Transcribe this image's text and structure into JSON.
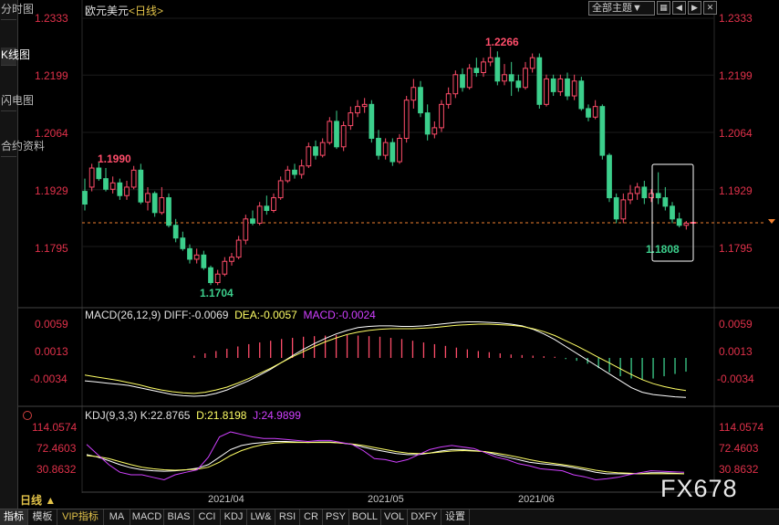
{
  "left_tabs": [
    "分时图",
    "K线图",
    "闪电图",
    "合约资料"
  ],
  "header": {
    "symbol": "欧元美元",
    "period_open": "<",
    "period": "日线",
    "period_close": ">",
    "theme_select": "全部主题▼",
    "window_buttons": [
      "▦",
      "◀",
      "▶",
      "✕"
    ]
  },
  "price_axis": [
    "1.2333",
    "1.2199",
    "1.2064",
    "1.1929",
    "1.1795"
  ],
  "annotations": {
    "low_left": "1.1704",
    "high_left": "1.1990",
    "peak": "1.2266",
    "last_low": "1.1808"
  },
  "macd": {
    "title": "MACD(26,12,9)",
    "diff": "DIFF:-0.0069",
    "dea": "DEA:-0.0057",
    "macd": "MACD:-0.0024",
    "axis": [
      "0.0059",
      "0.0013",
      "-0.0034"
    ]
  },
  "kdj": {
    "title": "KDJ(9,3,3)",
    "k": "K:22.8765",
    "d": "D:21.8198",
    "j": "J:24.9899",
    "axis": [
      "114.0574",
      "72.4603",
      "30.8632"
    ]
  },
  "period_button": "日线 ▲",
  "dates": [
    "2021/04",
    "2021/05",
    "2021/06"
  ],
  "bottom_tabs": [
    "指标",
    "模板",
    "VIP指标",
    "MA",
    "MACD",
    "BIAS",
    "CCI",
    "KDJ",
    "LW&",
    "RSI",
    "CR",
    "PSY",
    "BOLL",
    "VOL",
    "DXFY",
    "设置"
  ],
  "watermark": "FX678",
  "colors": {
    "up": "#ff4d6a",
    "down": "#3ccf8c",
    "price_text": "#e0314a",
    "diff_line": "#ffffff",
    "dea_line": "#ffff66",
    "j_line": "#d040ff"
  },
  "chart_data": {
    "type": "candlestick",
    "title": "欧元美元 日线",
    "x_ticks": [
      "2021/04",
      "2021/05",
      "2021/06"
    ],
    "y_ticks": [
      1.2333,
      1.2199,
      1.2064,
      1.1929,
      1.1795
    ],
    "ylim": [
      1.167,
      1.2345
    ],
    "current_level": 1.1851,
    "candles": [
      [
        1.1925,
        1.1955,
        1.1895,
        1.188
      ],
      [
        1.1935,
        1.199,
        1.198,
        1.1925
      ],
      [
        1.198,
        1.1995,
        1.1955,
        1.195
      ],
      [
        1.1955,
        1.198,
        1.193,
        1.1925
      ],
      [
        1.193,
        1.196,
        1.1945,
        1.192
      ],
      [
        1.1945,
        1.1955,
        1.1915,
        1.1905
      ],
      [
        1.1915,
        1.195,
        1.1935,
        1.1905
      ],
      [
        1.1935,
        1.1985,
        1.1975,
        1.193
      ],
      [
        1.1975,
        1.199,
        1.19,
        1.1895
      ],
      [
        1.19,
        1.1935,
        1.192,
        1.188
      ],
      [
        1.192,
        1.1925,
        1.1875,
        1.1865
      ],
      [
        1.1875,
        1.1935,
        1.191,
        1.187
      ],
      [
        1.191,
        1.192,
        1.1845,
        1.184
      ],
      [
        1.1845,
        1.186,
        1.1815,
        1.1805
      ],
      [
        1.1815,
        1.183,
        1.179,
        1.1785
      ],
      [
        1.179,
        1.18,
        1.1765,
        1.1755
      ],
      [
        1.1765,
        1.179,
        1.1775,
        1.1755
      ],
      [
        1.1775,
        1.1785,
        1.1745,
        1.174
      ],
      [
        1.1745,
        1.175,
        1.171,
        1.1704
      ],
      [
        1.171,
        1.174,
        1.173,
        1.1704
      ],
      [
        1.173,
        1.177,
        1.176,
        1.1725
      ],
      [
        1.176,
        1.178,
        1.177,
        1.175
      ],
      [
        1.177,
        1.182,
        1.181,
        1.1765
      ],
      [
        1.181,
        1.187,
        1.186,
        1.18
      ],
      [
        1.186,
        1.188,
        1.185,
        1.1845
      ],
      [
        1.185,
        1.19,
        1.189,
        1.1845
      ],
      [
        1.189,
        1.1915,
        1.188,
        1.187
      ],
      [
        1.188,
        1.192,
        1.191,
        1.1875
      ],
      [
        1.191,
        1.196,
        1.195,
        1.1905
      ],
      [
        1.195,
        1.1985,
        1.1975,
        1.1945
      ],
      [
        1.1975,
        1.199,
        1.1965,
        1.1955
      ],
      [
        1.1965,
        1.2,
        1.1985,
        1.1955
      ],
      [
        1.1985,
        1.204,
        1.203,
        1.198
      ],
      [
        1.203,
        1.2045,
        1.201,
        1.2
      ],
      [
        1.201,
        1.205,
        1.204,
        1.2005
      ],
      [
        1.204,
        1.21,
        1.209,
        1.2035
      ],
      [
        1.209,
        1.2115,
        1.203,
        1.2025
      ],
      [
        1.203,
        1.209,
        1.208,
        1.202
      ],
      [
        1.208,
        1.2125,
        1.211,
        1.207
      ],
      [
        1.211,
        1.214,
        1.2125,
        1.21
      ],
      [
        1.2125,
        1.2145,
        1.213,
        1.211
      ],
      [
        1.213,
        1.214,
        1.205,
        1.204
      ],
      [
        1.205,
        1.207,
        1.201,
        1.2
      ],
      [
        1.201,
        1.205,
        1.204,
        1.2
      ],
      [
        1.204,
        1.205,
        1.1995,
        1.1985
      ],
      [
        1.1995,
        1.206,
        1.205,
        1.199
      ],
      [
        1.205,
        1.215,
        1.214,
        1.204
      ],
      [
        1.214,
        1.219,
        1.217,
        1.212
      ],
      [
        1.217,
        1.2185,
        1.211,
        1.21
      ],
      [
        1.211,
        1.213,
        1.206,
        1.2045
      ],
      [
        1.206,
        1.209,
        1.2075,
        1.205
      ],
      [
        1.2075,
        1.214,
        1.213,
        1.2065
      ],
      [
        1.213,
        1.217,
        1.2155,
        1.212
      ],
      [
        1.2155,
        1.221,
        1.22,
        1.2145
      ],
      [
        1.22,
        1.2215,
        1.217,
        1.216
      ],
      [
        1.217,
        1.2225,
        1.2215,
        1.2165
      ],
      [
        1.2215,
        1.224,
        1.2205,
        1.2195
      ],
      [
        1.2205,
        1.224,
        1.223,
        1.2195
      ],
      [
        1.223,
        1.2266,
        1.224,
        1.222
      ],
      [
        1.224,
        1.2255,
        1.2185,
        1.2175
      ],
      [
        1.2185,
        1.2225,
        1.22,
        1.2175
      ],
      [
        1.22,
        1.223,
        1.2185,
        1.215
      ],
      [
        1.2185,
        1.22,
        1.217,
        1.216
      ],
      [
        1.217,
        1.223,
        1.2215,
        1.2165
      ],
      [
        1.2215,
        1.225,
        1.224,
        1.2205
      ],
      [
        1.224,
        1.225,
        1.213,
        1.212
      ],
      [
        1.213,
        1.22,
        1.219,
        1.2125
      ],
      [
        1.219,
        1.22,
        1.216,
        1.215
      ],
      [
        1.216,
        1.22,
        1.219,
        1.215
      ],
      [
        1.219,
        1.2205,
        1.215,
        1.214
      ],
      [
        1.215,
        1.22,
        1.2185,
        1.214
      ],
      [
        1.2185,
        1.2195,
        1.212,
        1.2115
      ],
      [
        1.212,
        1.213,
        1.21,
        1.209
      ],
      [
        1.21,
        1.214,
        1.2125,
        1.2095
      ],
      [
        1.2125,
        1.213,
        1.201,
        1.2
      ],
      [
        1.201,
        1.2015,
        1.191,
        1.19
      ],
      [
        1.191,
        1.192,
        1.186,
        1.185
      ],
      [
        1.186,
        1.192,
        1.1905,
        1.185
      ],
      [
        1.1905,
        1.194,
        1.192,
        1.1895
      ],
      [
        1.192,
        1.1945,
        1.1935,
        1.1905
      ],
      [
        1.1935,
        1.195,
        1.191,
        1.1895
      ],
      [
        1.191,
        1.193,
        1.192,
        1.19
      ],
      [
        1.192,
        1.197,
        1.191,
        1.1895
      ],
      [
        1.191,
        1.1935,
        1.189,
        1.188
      ],
      [
        1.189,
        1.19,
        1.186,
        1.185
      ],
      [
        1.186,
        1.1875,
        1.1845,
        1.184
      ],
      [
        1.1845,
        1.1855,
        1.185,
        1.1835
      ],
      [
        1.185,
        1.1865,
        1.1852,
        1.1808
      ]
    ],
    "macd_series": {
      "ylim": [
        -0.0075,
        0.0075
      ],
      "diff": [
        -0.004,
        -0.0042,
        -0.0044,
        -0.0046,
        -0.0048,
        -0.0052,
        -0.0056,
        -0.006,
        -0.0064,
        -0.0066,
        -0.0067,
        -0.0066,
        -0.0062,
        -0.0056,
        -0.0048,
        -0.004,
        -0.003,
        -0.002,
        -0.0008,
        0.0004,
        0.0015,
        0.0025,
        0.0034,
        0.0042,
        0.0048,
        0.0053,
        0.0055,
        0.0056,
        0.0056,
        0.0055,
        0.0055,
        0.0056,
        0.0058,
        0.006,
        0.0062,
        0.0063,
        0.0063,
        0.0062,
        0.0061,
        0.0059,
        0.0056,
        0.005,
        0.0042,
        0.0032,
        0.002,
        0.0008,
        -0.0004,
        -0.0016,
        -0.0028,
        -0.004,
        -0.0052,
        -0.006,
        -0.0064,
        -0.0066,
        -0.0068,
        -0.0069
      ],
      "dea": [
        -0.003,
        -0.0033,
        -0.0036,
        -0.0039,
        -0.0043,
        -0.0047,
        -0.0052,
        -0.0056,
        -0.0059,
        -0.0061,
        -0.0062,
        -0.006,
        -0.0056,
        -0.0051,
        -0.0044,
        -0.0036,
        -0.0027,
        -0.0018,
        -0.0008,
        0.0002,
        0.0011,
        0.002,
        0.0028,
        0.0035,
        0.0041,
        0.0045,
        0.0048,
        0.005,
        0.0051,
        0.0051,
        0.0051,
        0.0052,
        0.0053,
        0.0055,
        0.0057,
        0.0058,
        0.0059,
        0.0059,
        0.0058,
        0.0057,
        0.0055,
        0.0051,
        0.0046,
        0.0039,
        0.003,
        0.0021,
        0.0011,
        0.0001,
        -0.0009,
        -0.0019,
        -0.0029,
        -0.0038,
        -0.0045,
        -0.005,
        -0.0054,
        -0.0057
      ],
      "hist": [
        0,
        0,
        0,
        0,
        0,
        0,
        0,
        0,
        0,
        0,
        0.0004,
        0.0008,
        0.0012,
        0.0016,
        0.002,
        0.0024,
        0.0027,
        0.003,
        0.0033,
        0.0035,
        0.0037,
        0.0038,
        0.0039,
        0.004,
        0.004,
        0.0039,
        0.0038,
        0.0037,
        0.0035,
        0.0033,
        0.003,
        0.0027,
        0.0024,
        0.0021,
        0.0018,
        0.0015,
        0.0012,
        0.001,
        0.0008,
        0.0006,
        0.0005,
        0.0004,
        0.0003,
        0.0002,
        -0.0002,
        -0.0005,
        -0.001,
        -0.0018,
        -0.0025,
        -0.0032,
        -0.0036,
        -0.0038,
        -0.0036,
        -0.0032,
        -0.0028,
        -0.0024
      ]
    },
    "kdj_series": {
      "ylim": [
        0,
        130
      ],
      "k": [
        60,
        55,
        48,
        40,
        34,
        30,
        28,
        27,
        28,
        30,
        33,
        40,
        55,
        70,
        78,
        82,
        84,
        86,
        86,
        85,
        84,
        85,
        85,
        83,
        80,
        75,
        70,
        66,
        62,
        60,
        60,
        63,
        67,
        70,
        70,
        68,
        66,
        60,
        55,
        50,
        45,
        42,
        40,
        38,
        34,
        30,
        25,
        22,
        22,
        22,
        22,
        24,
        24,
        23,
        22
      ],
      "d": [
        58,
        56,
        52,
        46,
        40,
        35,
        32,
        30,
        29,
        30,
        31,
        35,
        45,
        58,
        68,
        75,
        80,
        83,
        84,
        84,
        84,
        84,
        84,
        83,
        81,
        78,
        74,
        70,
        66,
        63,
        62,
        63,
        65,
        67,
        68,
        67,
        66,
        63,
        59,
        55,
        50,
        46,
        43,
        40,
        37,
        33,
        29,
        26,
        24,
        23,
        22,
        22,
        22,
        22,
        22
      ],
      "j": [
        80,
        60,
        40,
        25,
        20,
        20,
        15,
        10,
        20,
        25,
        30,
        55,
        95,
        105,
        100,
        95,
        92,
        92,
        90,
        88,
        86,
        88,
        88,
        84,
        80,
        68,
        52,
        50,
        45,
        50,
        60,
        70,
        75,
        78,
        75,
        72,
        64,
        55,
        50,
        42,
        38,
        32,
        30,
        28,
        20,
        16,
        10,
        12,
        15,
        20,
        24,
        28,
        27,
        26,
        25
      ]
    }
  }
}
